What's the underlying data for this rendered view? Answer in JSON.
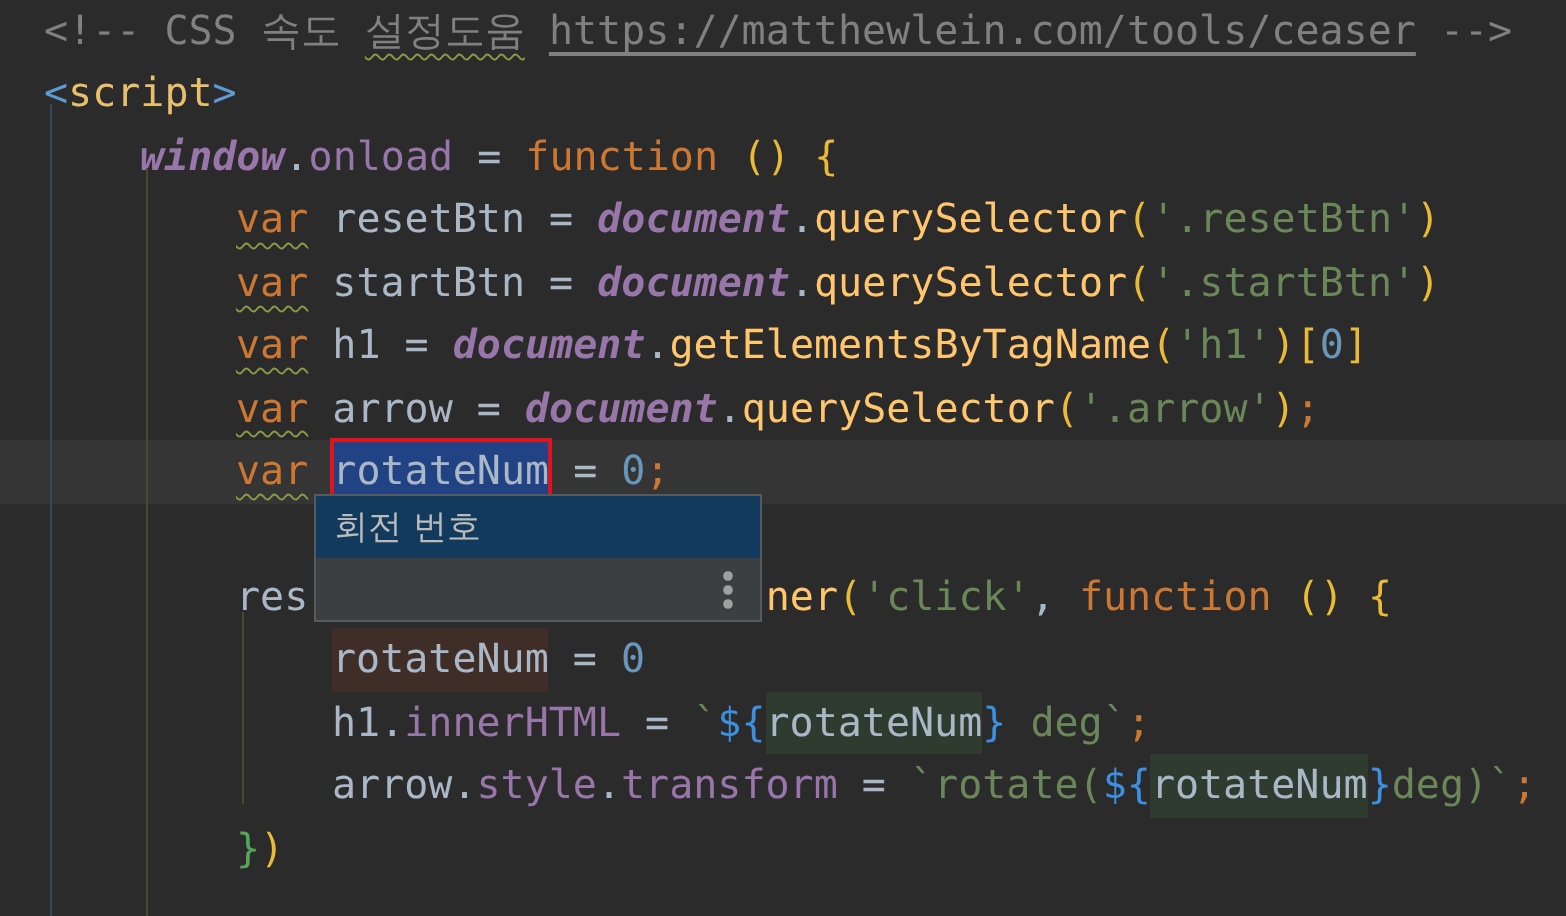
{
  "editor": {
    "lines": [
      {
        "kind": "code",
        "tokens": [
          {
            "text": "<!-- CSS 속도 ",
            "kind": "comment"
          },
          {
            "text": "설정도움",
            "kind": "comment",
            "typo": true
          },
          {
            "text": "https://matthewlein.com/tools/ceaser",
            "kind": "link"
          },
          {
            "text": " -->",
            "kind": "comment"
          }
        ]
      },
      {
        "kind": "code",
        "tokens": [
          {
            "text": "<",
            "kind": "tag-bracket"
          },
          {
            "text": "script",
            "kind": "tag"
          },
          {
            "text": ">",
            "kind": "tag-bracket"
          }
        ],
        "children": [
          {
            "kind": "code",
            "tokens": [
              {
                "text": "window",
                "kind": "global"
              },
              {
                "text": ".",
                "kind": "plain"
              },
              {
                "text": "onload",
                "kind": "field"
              },
              {
                "text": " = ",
                "kind": "plain"
              },
              {
                "text": "function",
                "kind": "keyword"
              },
              {
                "text": " () {",
                "kind": "paren"
              }
            ],
            "children": [
              {
                "kind": "code",
                "tokens": [
                  {
                    "text": "var",
                    "kind": "keyword",
                    "typo": true
                  },
                  {
                    "text": " resetBtn = ",
                    "kind": "plain"
                  },
                  {
                    "text": "document",
                    "kind": "global"
                  },
                  {
                    "text": ".",
                    "kind": "plain"
                  },
                  {
                    "text": "querySelector",
                    "kind": "method"
                  },
                  {
                    "text": "(",
                    "kind": "paren"
                  },
                  {
                    "text": "'.resetBtn'",
                    "kind": "string"
                  },
                  {
                    "text": ")",
                    "kind": "paren"
                  }
                ]
              },
              {
                "kind": "code",
                "tokens": [
                  {
                    "text": "var",
                    "kind": "keyword",
                    "typo": true
                  },
                  {
                    "text": " startBtn = ",
                    "kind": "plain"
                  },
                  {
                    "text": "document",
                    "kind": "global"
                  },
                  {
                    "text": ".",
                    "kind": "plain"
                  },
                  {
                    "text": "querySelector",
                    "kind": "method"
                  },
                  {
                    "text": "(",
                    "kind": "paren"
                  },
                  {
                    "text": "'.startBtn'",
                    "kind": "string"
                  },
                  {
                    "text": ")",
                    "kind": "paren"
                  }
                ]
              },
              {
                "kind": "code",
                "tokens": [
                  {
                    "text": "var",
                    "kind": "keyword",
                    "typo": true
                  },
                  {
                    "text": " h1 = ",
                    "kind": "plain"
                  },
                  {
                    "text": "document",
                    "kind": "global"
                  },
                  {
                    "text": ".",
                    "kind": "plain"
                  },
                  {
                    "text": "getElementsByTagName",
                    "kind": "method"
                  },
                  {
                    "text": "(",
                    "kind": "paren"
                  },
                  {
                    "text": "'h1'",
                    "kind": "string"
                  },
                  {
                    "text": ")[",
                    "kind": "paren"
                  },
                  {
                    "text": "0",
                    "kind": "number"
                  },
                  {
                    "text": "]",
                    "kind": "paren"
                  }
                ]
              },
              {
                "kind": "code",
                "tokens": [
                  {
                    "text": "var",
                    "kind": "keyword",
                    "typo": true
                  },
                  {
                    "text": " arrow = ",
                    "kind": "plain"
                  },
                  {
                    "text": "document",
                    "kind": "global"
                  },
                  {
                    "text": ".",
                    "kind": "plain"
                  },
                  {
                    "text": "querySelector",
                    "kind": "method"
                  },
                  {
                    "text": "(",
                    "kind": "paren"
                  },
                  {
                    "text": "'.arrow'",
                    "kind": "string"
                  },
                  {
                    "text": ")",
                    "kind": "paren"
                  },
                  {
                    "text": ";",
                    "kind": "keyword"
                  }
                ]
              },
              {
                "kind": "code",
                "tokens": [
                  {
                    "text": "var",
                    "kind": "keyword",
                    "typo": true
                  },
                  {
                    "text": "rotateNum",
                    "kind": "plain",
                    "selected": true
                  },
                  {
                    "text": " = ",
                    "kind": "plain"
                  },
                  {
                    "text": "0",
                    "kind": "number"
                  },
                  {
                    "text": ";",
                    "kind": "keyword"
                  }
                ]
              },
              {
                "kind": "blank"
              },
              {
                "kind": "code",
                "tokens": [
                  {
                    "text": "res",
                    "kind": "plain"
                  },
                  {
                    "kind": "covered"
                  },
                  {
                    "text": "ner",
                    "kind": "method"
                  },
                  {
                    "text": "(",
                    "kind": "paren"
                  },
                  {
                    "text": "'click'",
                    "kind": "string"
                  },
                  {
                    "text": ", ",
                    "kind": "plain"
                  },
                  {
                    "text": "function",
                    "kind": "keyword"
                  },
                  {
                    "text": " () {",
                    "kind": "paren"
                  }
                ],
                "children": [
                  {
                    "kind": "code",
                    "tokens": [
                      {
                        "text": "rotateNum",
                        "kind": "plain",
                        "write_usage": true
                      },
                      {
                        "text": " = ",
                        "kind": "plain"
                      },
                      {
                        "text": "0",
                        "kind": "number"
                      }
                    ]
                  },
                  {
                    "kind": "code",
                    "tokens": [
                      {
                        "text": "h1.",
                        "kind": "plain"
                      },
                      {
                        "text": "innerHTML",
                        "kind": "field"
                      },
                      {
                        "text": " = ",
                        "kind": "plain"
                      },
                      {
                        "text": "`",
                        "kind": "string"
                      },
                      {
                        "text": "${",
                        "kind": "template"
                      },
                      {
                        "text": "rotateNum",
                        "kind": "plain",
                        "injected": true
                      },
                      {
                        "text": "}",
                        "kind": "template"
                      },
                      {
                        "text": " deg`",
                        "kind": "string"
                      },
                      {
                        "text": ";",
                        "kind": "keyword"
                      }
                    ]
                  },
                  {
                    "kind": "code",
                    "tokens": [
                      {
                        "text": "arrow.",
                        "kind": "plain"
                      },
                      {
                        "text": "style",
                        "kind": "field"
                      },
                      {
                        "text": ".",
                        "kind": "plain"
                      },
                      {
                        "text": "transform",
                        "kind": "field"
                      },
                      {
                        "text": " = ",
                        "kind": "plain"
                      },
                      {
                        "text": "`rotate(",
                        "kind": "string"
                      },
                      {
                        "text": "${",
                        "kind": "template"
                      },
                      {
                        "text": "rotateNum",
                        "kind": "plain",
                        "injected": true
                      },
                      {
                        "text": "}",
                        "kind": "template"
                      },
                      {
                        "text": "deg)`",
                        "kind": "string"
                      },
                      {
                        "text": ";",
                        "kind": "keyword"
                      }
                    ]
                  }
                ]
              },
              {
                "kind": "code",
                "tokens": [
                  {
                    "text": "}",
                    "kind": "brace-green"
                  },
                  {
                    "text": ")",
                    "kind": "paren"
                  }
                ]
              }
            ]
          }
        ]
      }
    ],
    "popup": {
      "items": [
        {
          "text": "회전 번호",
          "selected": true
        }
      ]
    }
  }
}
